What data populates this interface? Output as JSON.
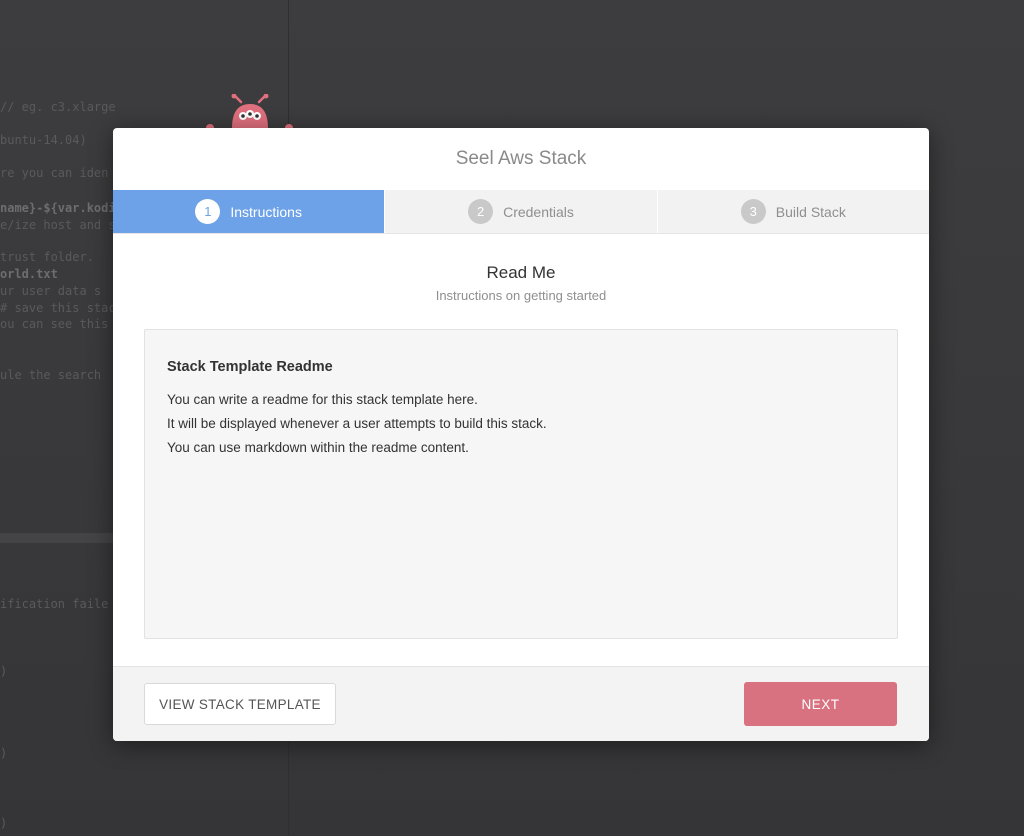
{
  "background_code": {
    "lines": [
      "// eg. c3.xlarge",
      "buntu-14.04)",
      "re you can iden",
      "name}-${var.kodi",
      "e/ize host and so",
      "trust folder.",
      "orld.txt",
      "ur user data s",
      "# save this stac",
      "ou can see this",
      "ule the search",
      "ification faile",
      ")",
      ")",
      ")"
    ]
  },
  "modal": {
    "title": "Seel Aws Stack",
    "steps": [
      {
        "number": "1",
        "label": "Instructions"
      },
      {
        "number": "2",
        "label": "Credentials"
      },
      {
        "number": "3",
        "label": "Build Stack"
      }
    ],
    "section_title": "Read Me",
    "section_subtitle": "Instructions on getting started",
    "readme": {
      "heading": "Stack Template Readme",
      "lines": [
        "You can write a readme for this stack template here.",
        "It will be displayed whenever a user attempts to build this stack.",
        "You can use markdown within the readme content."
      ]
    },
    "footer": {
      "view_template_label": "VIEW STACK TEMPLATE",
      "next_label": "NEXT"
    }
  },
  "colors": {
    "active_step": "#6ea2e8",
    "next_button": "#d97280",
    "mascot": "#e0707e"
  },
  "icons": {
    "mascot": "pink-robot-mascot-icon"
  }
}
